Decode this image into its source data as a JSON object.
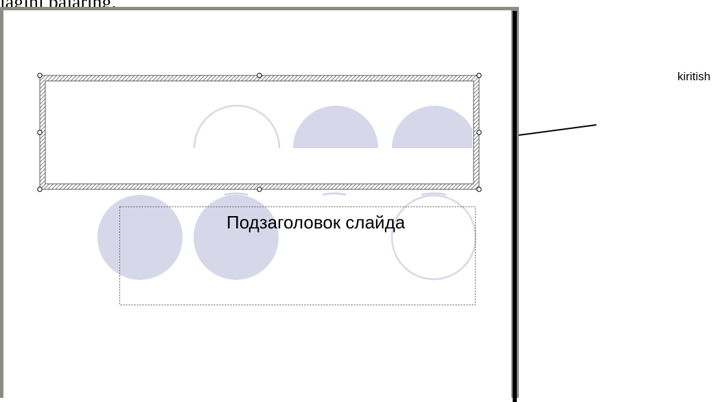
{
  "caption": {
    "text": "lagini bajaring."
  },
  "slide": {
    "subtitle_placeholder": "Подзаголовок слайда",
    "title_placeholder_state": "selected",
    "decoration_color": "#d7d7ea",
    "decoration_icon": "circle-pattern"
  },
  "annotation": {
    "label": "kiritish"
  }
}
